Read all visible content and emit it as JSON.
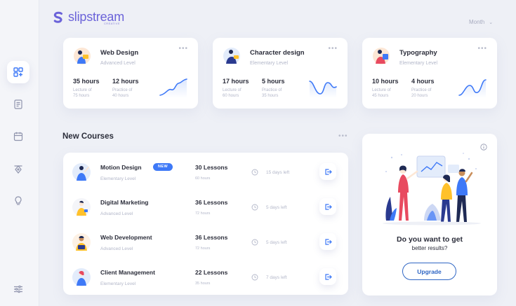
{
  "brand": {
    "name": "slipstream",
    "tagline": "CREATIVE",
    "color": "#6b63d9"
  },
  "filter": {
    "label": "Month"
  },
  "sidebar": {
    "items": [
      {
        "icon": "dashboard-icon",
        "active": true
      },
      {
        "icon": "document-icon",
        "active": false
      },
      {
        "icon": "calendar-icon",
        "active": false
      },
      {
        "icon": "pen-tool-icon",
        "active": false
      },
      {
        "icon": "lightbulb-icon",
        "active": false
      },
      {
        "icon": "settings-sliders-icon",
        "active": false
      }
    ]
  },
  "courses": [
    {
      "title": "Web Design",
      "level": "Advanced Level",
      "lecture_hours": "35 hours",
      "lecture_label": "Lecture of",
      "lecture_sub": "75 hours",
      "practice_hours": "12 hours",
      "practice_label": "Practice of",
      "practice_sub": "40 hours"
    },
    {
      "title": "Character design",
      "level": "Elementary Level",
      "lecture_hours": "17 hours",
      "lecture_label": "Lecture of",
      "lecture_sub": "60 hours",
      "practice_hours": "5 hours",
      "practice_label": "Practice of",
      "practice_sub": "35 hours"
    },
    {
      "title": "Typography",
      "level": "Elementary Level",
      "lecture_hours": "10 hours",
      "lecture_label": "Lecture of",
      "lecture_sub": "45 hours",
      "practice_hours": "4 hours",
      "practice_label": "Practice of",
      "practice_sub": "20 hours"
    }
  ],
  "new_courses": {
    "title": "New Courses",
    "rows": [
      {
        "name": "Motion Design",
        "level": "Elementary Level",
        "badge": "NEW",
        "lessons": "30 Lessons",
        "minutes": "60 hours",
        "time_left": "15 days left"
      },
      {
        "name": "Digital Marketing",
        "level": "Advanced Level",
        "badge": "",
        "lessons": "36 Lessons",
        "minutes": "72 hours",
        "time_left": "5 days left"
      },
      {
        "name": "Web Development",
        "level": "Advanced Level",
        "badge": "",
        "lessons": "36 Lessons",
        "minutes": "72 hours",
        "time_left": "5 days left"
      },
      {
        "name": "Client Management",
        "level": "Elementary Level",
        "badge": "",
        "lessons": "22 Lessons",
        "minutes": "35 hours",
        "time_left": "7 days left"
      }
    ]
  },
  "upgrade": {
    "question": "Do you want to get",
    "question_sub": "better results?",
    "button": "Upgrade"
  },
  "colors": {
    "accent": "#3e79f7",
    "button_outline": "#2f66c4"
  }
}
